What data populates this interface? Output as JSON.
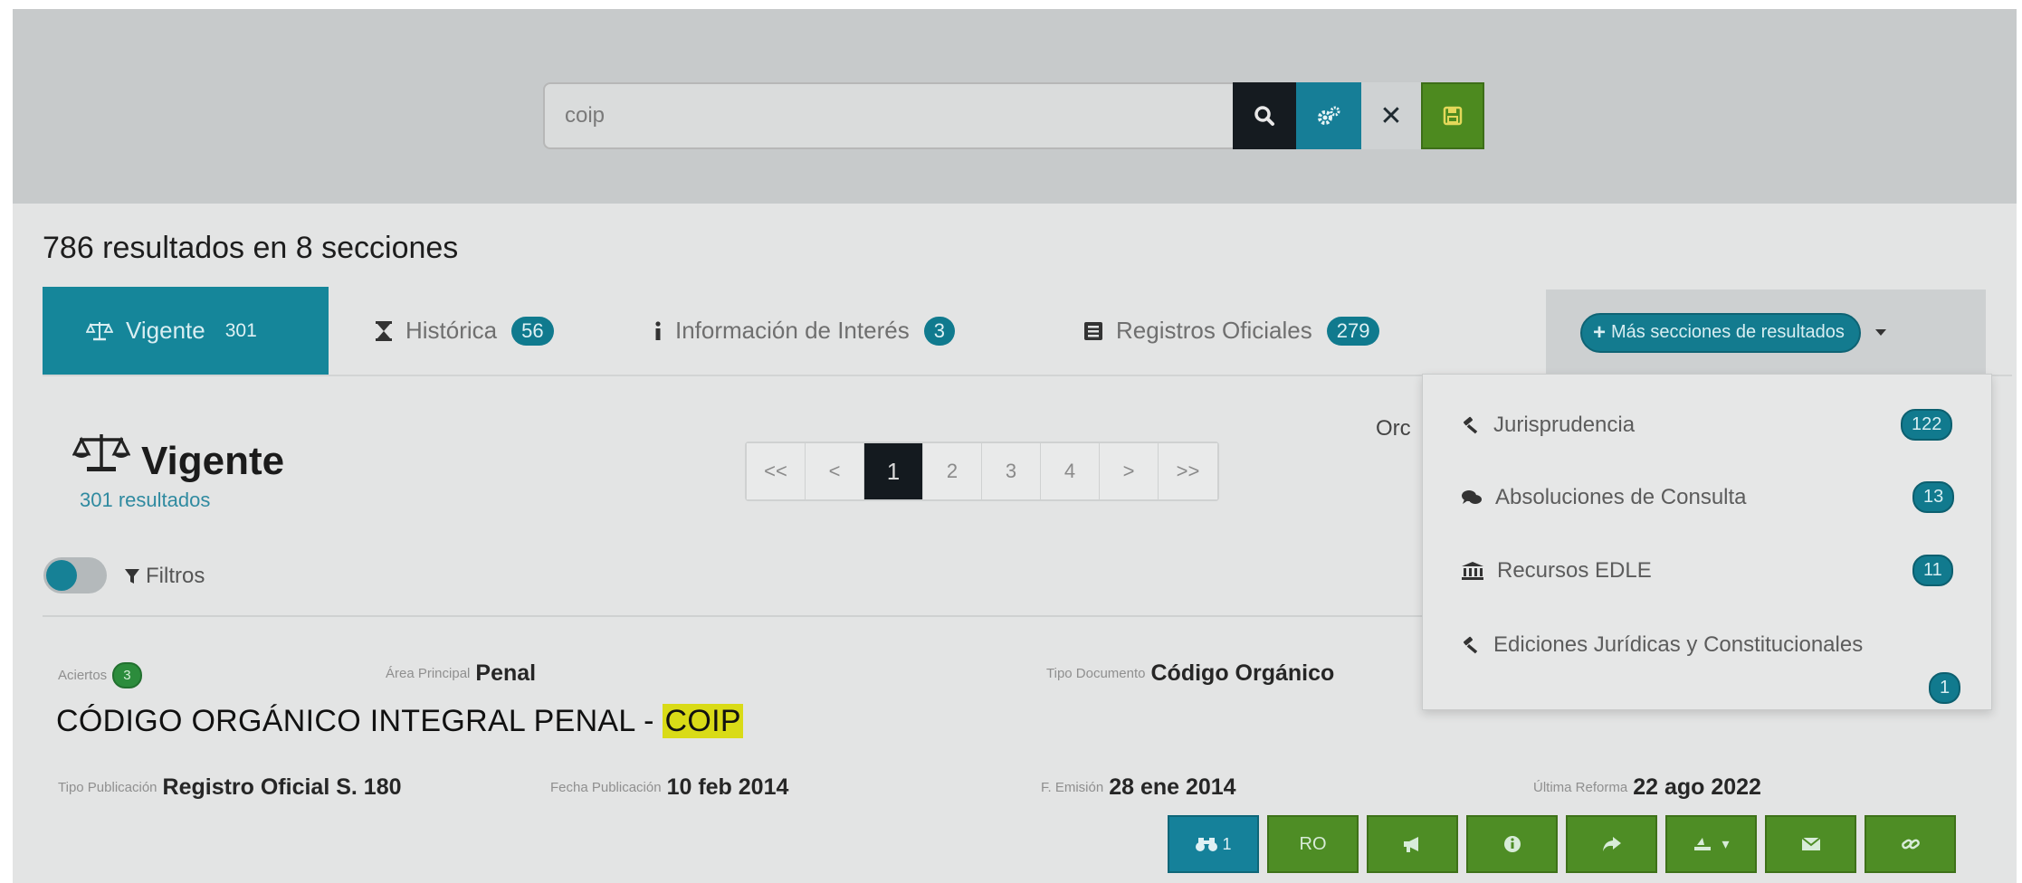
{
  "search": {
    "value": "coip",
    "placeholder": ""
  },
  "results": {
    "summary": "786 resultados en 8 secciones"
  },
  "tabs": [
    {
      "label": "Vigente",
      "count": "301"
    },
    {
      "label": "Histórica",
      "count": "56"
    },
    {
      "label": "Información de Interés",
      "count": "3"
    },
    {
      "label": "Registros Oficiales",
      "count": "279"
    }
  ],
  "more_sections": {
    "label": "Más secciones de resultados"
  },
  "dropdown": [
    {
      "label": "Jurisprudencia",
      "count": "122",
      "icon": "gavel-icon"
    },
    {
      "label": "Absoluciones de Consulta",
      "count": "13",
      "icon": "comments-icon"
    },
    {
      "label": "Recursos EDLE",
      "count": "11",
      "icon": "institution-icon"
    },
    {
      "label": "Ediciones Jurídicas y Constitucionales",
      "count": "1",
      "icon": "gavel-icon"
    }
  ],
  "section": {
    "title": "Vigente",
    "subtitle": "301 resultados"
  },
  "pagination": {
    "first": "<<",
    "prev": "<",
    "pages": [
      "1",
      "2",
      "3",
      "4"
    ],
    "active": "1",
    "next": ">",
    "last": ">>"
  },
  "order_label": "Orc",
  "filters": {
    "label": "Filtros"
  },
  "result": {
    "aciertos_label": "Aciertos",
    "aciertos_count": "3",
    "area_label": "Área Principal",
    "area_value": "Penal",
    "tipo_doc_label": "Tipo Documento",
    "tipo_doc_value": "Código Orgánico",
    "title_main": "CÓDIGO ORGÁNICO INTEGRAL PENAL - ",
    "title_highlight": "COIP",
    "tipo_pub_label": "Tipo Publicación",
    "tipo_pub_value": "Registro Oficial S. 180",
    "fecha_pub_label": "Fecha Publicación",
    "fecha_pub_value": "10 feb 2014",
    "f_emision_label": "F. Emisión",
    "f_emision_value": "28 ene 2014",
    "ultima_reforma_label": "Última Reforma",
    "ultima_reforma_value": "22 ago 2022"
  },
  "actions": {
    "view_count": "1",
    "ro_label": "RO"
  },
  "colors": {
    "teal": "#15869a",
    "green": "#4e8d25",
    "dark": "#141a1f",
    "highlight": "#d9db17"
  }
}
